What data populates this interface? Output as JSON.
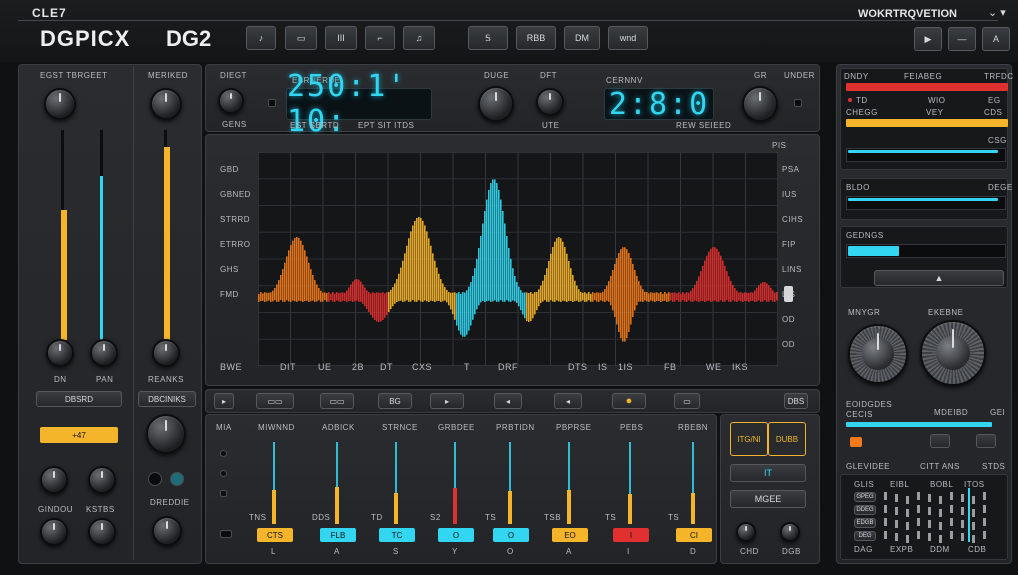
{
  "header": {
    "small_title": "CLE7",
    "brand": "DGPICX",
    "model": "DG2",
    "right_title": "WOKRTRQVETION",
    "menu_items": [
      {
        "glyph": "♪",
        "icon": "note-icon"
      },
      {
        "glyph": "▭",
        "icon": "window-icon"
      },
      {
        "glyph": "III",
        "icon": "bars-icon"
      },
      {
        "glyph": "⌐",
        "icon": "curve-icon"
      },
      {
        "glyph": "♫",
        "icon": "notes-icon"
      }
    ],
    "center_buttons": [
      "Ꭶ",
      "RBB",
      "DM",
      "wnd"
    ],
    "right_buttons": [
      {
        "glyph": "▶",
        "icon": "play-icon"
      },
      {
        "glyph": "—",
        "icon": "minus-icon"
      },
      {
        "glyph": "A",
        "icon": "a-icon"
      }
    ]
  },
  "left_panel": {
    "col1_title": "EGST TBRGEET",
    "col2_title": "MERIKED",
    "labels": {
      "dn": "DN",
      "pan": "PAN",
      "reanks": "REANKS",
      "gindou": "GINDOU",
      "kstbs": "KSTBS",
      "dreddie": "DREDDIE"
    },
    "buttons": [
      "DBSRD",
      "DBCINIKS"
    ],
    "value_badge": "+47",
    "meter_left": 0.62,
    "meter_right": 0.78,
    "meter_mid": 0.92
  },
  "top_display": {
    "left_labels": {
      "diegt": "DIEGT",
      "gens": "GENS",
      "ebrnerde": "EBRNERDE",
      "sub": "EST SBRTD",
      "sub2": "EPT SIT ITDS"
    },
    "lcd1": "250:1' 10:",
    "lcd2": "2:8:0",
    "right_labels": {
      "duge": "DUGE",
      "dft": "DFT",
      "cerrnv": "CERNNV",
      "ute": "UTE",
      "gr": "GR",
      "under": "UNDER",
      "sub": "REW SEIEED"
    }
  },
  "graph": {
    "left_labels": [
      "GBD",
      "GBNED",
      "STRRD",
      "ETRRO",
      "GHS",
      "FMD"
    ],
    "right_labels": [
      "PSA",
      "IUS",
      "CIHS",
      "FIP",
      "LINS",
      "LIS",
      "OD",
      "OD"
    ],
    "bottom_labels": [
      "BWE",
      "DIT",
      "UE",
      "2B",
      "DT",
      "CXS",
      "T",
      "DRF",
      "DTS",
      "IS",
      "1IS",
      "FB",
      "WE",
      "IKS"
    ],
    "top_right": "PIS"
  },
  "transport": {
    "buttons": [
      "▸",
      "▭▭",
      "▭▭",
      "BG",
      "▸",
      "◂",
      "◂",
      "●",
      "▭",
      "DBS"
    ]
  },
  "mixer": {
    "headers": [
      "MIA",
      "MIWNND",
      "ADBICK",
      "STRNCE",
      "GRBDEE",
      "PRBTIDN",
      "PBPRSE",
      "PEBS",
      "RBEBN"
    ],
    "channels": [
      {
        "bottom": "CTS",
        "sub": "L",
        "pill_color": "#f5b52b",
        "top_label": "TNS",
        "fill_color": "#f5b52b",
        "level": 0.42
      },
      {
        "bottom": "FLB",
        "sub": "A",
        "pill_color": "#33d6f0",
        "top_label": "DDS",
        "fill_color": "#f5b52b",
        "level": 0.45
      },
      {
        "bottom": "TC",
        "sub": "S",
        "pill_color": "#33d6f0",
        "top_label": "TD",
        "fill_color": "#f5b52b",
        "level": 0.38
      },
      {
        "bottom": "O",
        "sub": "Y",
        "pill_color": "#33d6f0",
        "top_label": "S2",
        "fill_color": "#e03030",
        "level": 0.44
      },
      {
        "bottom": "O",
        "sub": "O",
        "pill_color": "#33d6f0",
        "top_label": "TS",
        "fill_color": "#f5b52b",
        "level": 0.4
      },
      {
        "bottom": "EO",
        "sub": "A",
        "pill_color": "#f5b52b",
        "top_label": "TSB",
        "fill_color": "#f5b52b",
        "level": 0.42
      },
      {
        "bottom": "I",
        "sub": "I",
        "pill_color": "#e03030",
        "top_label": "TS",
        "fill_color": "#f5b52b",
        "level": 0.36
      },
      {
        "bottom": "CI",
        "sub": "D",
        "pill_color": "#f5b52b",
        "top_label": "TS",
        "fill_color": "#f5b52b",
        "level": 0.38
      }
    ],
    "side_buttons": [
      "IT",
      "MGEE"
    ],
    "gold_boxes": [
      "ITG/NI",
      "DUBB"
    ],
    "bottom_labels": [
      "CHD",
      "DGB"
    ]
  },
  "right_panel": {
    "header": [
      "DNDY",
      "FEIABEG",
      "TRFDC"
    ],
    "row1": [
      "TD",
      "WIO",
      "EG"
    ],
    "row2": [
      "CHEGG",
      "VEY",
      "CDS"
    ],
    "row3": "CSG",
    "sec2": [
      "BLDO",
      "DEGE"
    ],
    "sec3": "GEDNGS",
    "sec4": [
      "MNYGR",
      "EKEBNE"
    ],
    "sec5": {
      "title": "EOIDGDES",
      "sub": "CECIS",
      "sub2": "MDEIBD",
      "sub3": "GEI"
    },
    "sec6": [
      "GLEVIDEE",
      "CITT ANS",
      "STDS"
    ],
    "sec7": [
      "GLIS",
      "EIBL",
      "BOBL",
      "ITOS"
    ],
    "sec7_rows": [
      "GPEG",
      "DDEG",
      "EDGB",
      "DEG"
    ],
    "sec7_bottom": [
      "DAG",
      "EXPB",
      "DDM",
      "CDB"
    ],
    "meter_red": 1.0,
    "meter_orange": 1.0,
    "meter_cyan1": 0.96,
    "meter_cyan2": 0.96,
    "meter_cyan3": 0.33,
    "meter_cyan4": 0.9
  },
  "colors": {
    "cyan": "#33d6f0",
    "amber": "#f5b52b",
    "red": "#e03030",
    "orange": "#f07a1a"
  }
}
